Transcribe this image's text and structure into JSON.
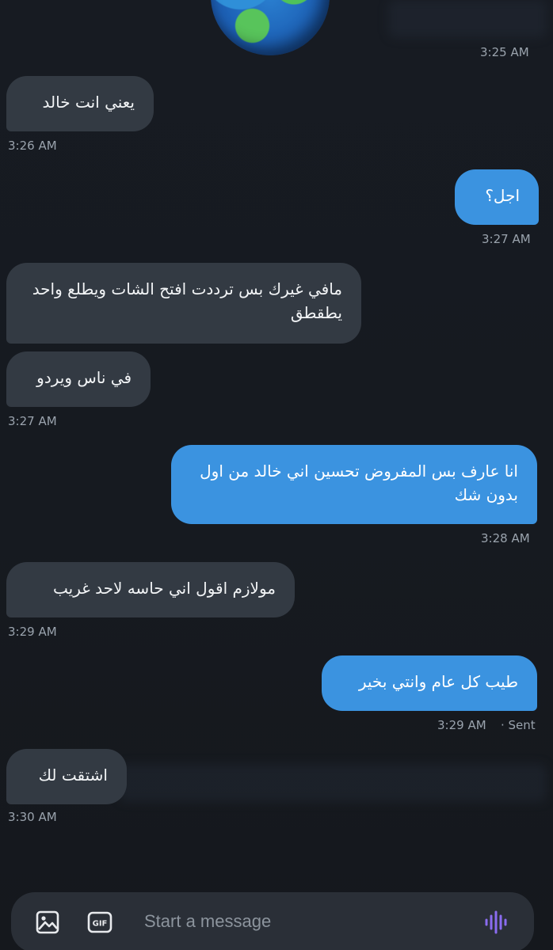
{
  "conversation": {
    "messages": [
      {
        "direction": "in",
        "text": ""
      },
      {
        "direction": "in",
        "text": "يعني انت خالد",
        "time": "3:26 AM"
      },
      {
        "direction": "out",
        "text": "اجل؟",
        "time": "3:27 AM"
      },
      {
        "direction": "in",
        "text": "مافي غيرك بس ترددت افتح الشات ويطلع واحد يطقطق"
      },
      {
        "direction": "in",
        "text": "في ناس ويردو",
        "time": "3:27 AM"
      },
      {
        "direction": "out",
        "text": "انا عارف بس المفروض تحسين اني خالد من اول بدون شك",
        "time": "3:28 AM"
      },
      {
        "direction": "in",
        "text": "مولازم اقول اني حاسه لاحد غريب",
        "time": "3:29 AM"
      },
      {
        "direction": "out",
        "text": "طيب كل عام وانتي بخير",
        "time": "3:29 AM",
        "status": "· Sent"
      },
      {
        "direction": "in",
        "text": "اشتقت لك",
        "time": "3:30 AM"
      }
    ],
    "top_time": "3:25 AM"
  },
  "composer": {
    "placeholder": "Start a message",
    "icons": [
      "image-icon",
      "gif-icon",
      "voice-icon"
    ],
    "gif_label": "GIF"
  },
  "colors": {
    "incoming_bubble": "#333a43",
    "outgoing_bubble": "#3b93e0",
    "voice_icon": "#8b6cf0"
  }
}
